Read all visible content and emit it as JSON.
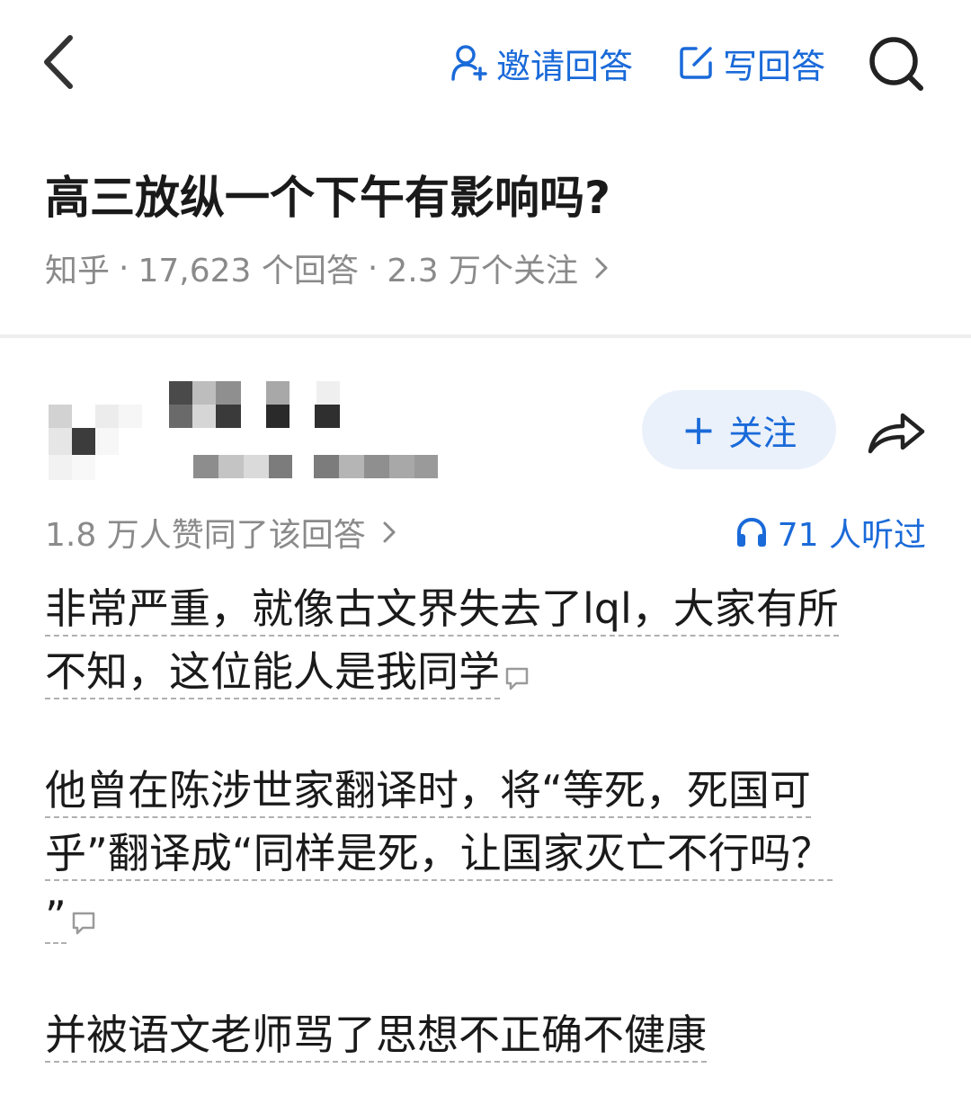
{
  "nav": {
    "invite_label": "邀请回答",
    "write_label": "写回答"
  },
  "question": {
    "title": "高三放纵一个下午有影响吗?",
    "source": "知乎",
    "answers": "17,623 个回答",
    "follows": "2.3 万个关注"
  },
  "answer": {
    "follow_label": "关注",
    "upvotes": "1.8 万人赞同了该回答",
    "listened": "71 人听过",
    "paragraphs": [
      {
        "lines": [
          "非常严重，就像古文界失去了lql，大家有所",
          "不知，这位能人是我同学"
        ]
      },
      {
        "lines": [
          "他曾在陈涉世家翻译时，将“等死，死国可",
          "乎”翻译成“同样是死，让国家灭亡不行吗？",
          "”"
        ]
      },
      {
        "lines": [
          "并被语文老师骂了思想不正确不健康"
        ]
      }
    ]
  },
  "colors": {
    "accent": "#1a6ad9",
    "muted": "#8a8a8a",
    "text": "#1a1a1a",
    "follow_bg": "#eaf1fb"
  }
}
